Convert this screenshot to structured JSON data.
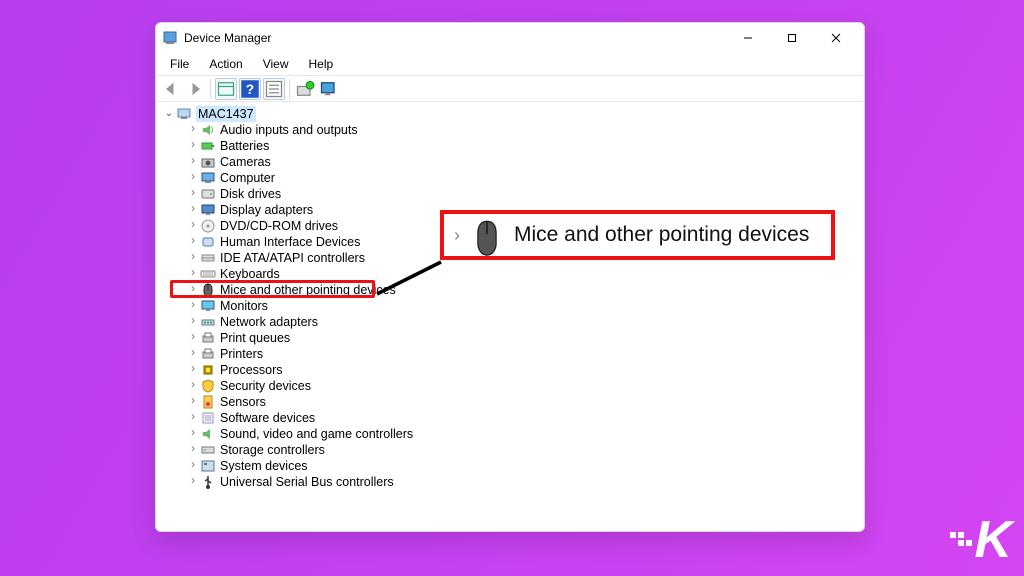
{
  "window": {
    "title": "Device Manager"
  },
  "menu": {
    "file": "File",
    "action": "Action",
    "view": "View",
    "help": "Help"
  },
  "tree": {
    "root": "MAC1437",
    "items": [
      {
        "label": "Audio inputs and outputs",
        "icon": "audio"
      },
      {
        "label": "Batteries",
        "icon": "battery"
      },
      {
        "label": "Cameras",
        "icon": "camera"
      },
      {
        "label": "Computer",
        "icon": "computer"
      },
      {
        "label": "Disk drives",
        "icon": "disk"
      },
      {
        "label": "Display adapters",
        "icon": "display"
      },
      {
        "label": "DVD/CD-ROM drives",
        "icon": "dvd"
      },
      {
        "label": "Human Interface Devices",
        "icon": "hid"
      },
      {
        "label": "IDE ATA/ATAPI controllers",
        "icon": "ide"
      },
      {
        "label": "Keyboards",
        "icon": "keyboard"
      },
      {
        "label": "Mice and other pointing devices",
        "icon": "mouse",
        "highlighted": true
      },
      {
        "label": "Monitors",
        "icon": "monitor"
      },
      {
        "label": "Network adapters",
        "icon": "network"
      },
      {
        "label": "Print queues",
        "icon": "printq"
      },
      {
        "label": "Printers",
        "icon": "printer"
      },
      {
        "label": "Processors",
        "icon": "cpu"
      },
      {
        "label": "Security devices",
        "icon": "security"
      },
      {
        "label": "Sensors",
        "icon": "sensor"
      },
      {
        "label": "Software devices",
        "icon": "software"
      },
      {
        "label": "Sound, video and game controllers",
        "icon": "sound"
      },
      {
        "label": "Storage controllers",
        "icon": "storage"
      },
      {
        "label": "System devices",
        "icon": "system"
      },
      {
        "label": "Universal Serial Bus controllers",
        "icon": "usb"
      }
    ]
  },
  "callout": {
    "text": "Mice and other pointing devices"
  }
}
